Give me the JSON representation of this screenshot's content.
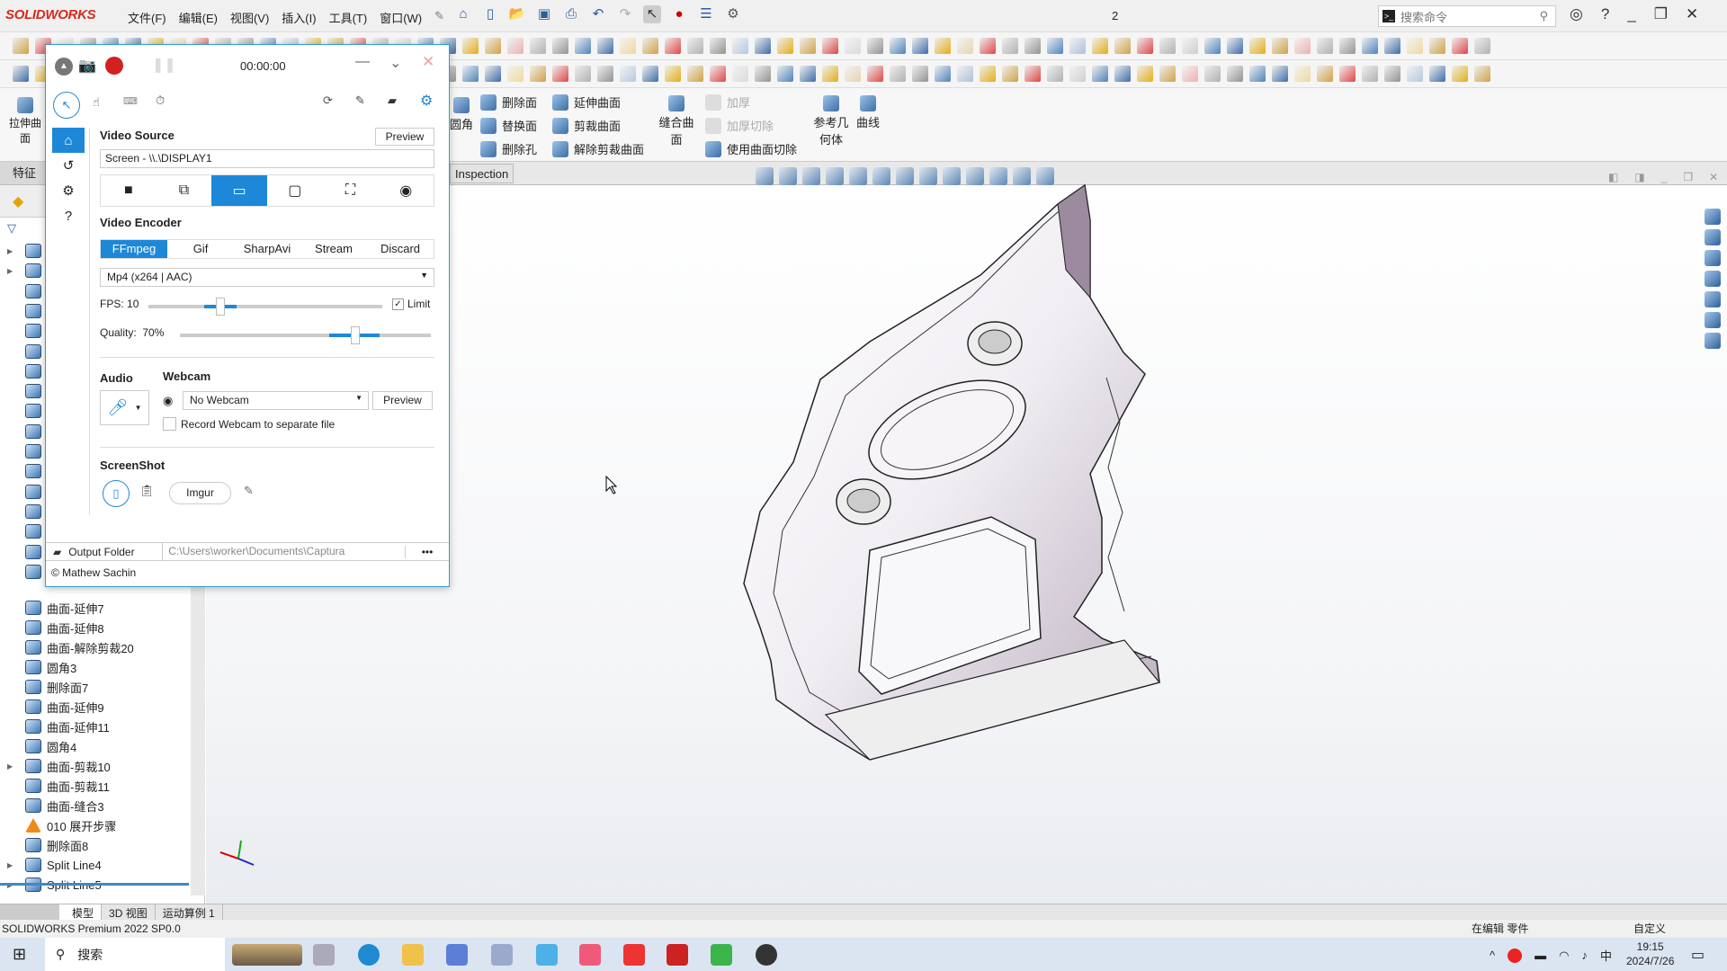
{
  "app": {
    "logo": "SOLIDWORKS",
    "doc_number": "2",
    "menu": [
      "文件(F)",
      "编辑(E)",
      "视图(V)",
      "插入(I)",
      "工具(T)",
      "窗口(W)"
    ],
    "search_placeholder": "搜索命令",
    "quick_access_icons": [
      "home-icon",
      "new-document-icon",
      "open-icon",
      "save-icon",
      "print-icon",
      "undo-icon",
      "redo-icon",
      "select-icon",
      "traffic-light-icon",
      "file-properties-icon",
      "options-gear-icon"
    ]
  },
  "ribbon": {
    "extrude_surface": "拉伸曲面",
    "fillet": "圆角",
    "col1": [
      "删除面",
      "替换面",
      "删除孔"
    ],
    "col2": [
      "延伸曲面",
      "剪裁曲面",
      "解除剪裁曲面"
    ],
    "knit": "缝合曲面",
    "col3": [
      "加厚",
      "加厚切除",
      "使用曲面切除"
    ],
    "ref_geom": "参考几何体",
    "curves": "曲线"
  },
  "tabs": {
    "feature": "特征",
    "inspection": "Inspection"
  },
  "tree": {
    "items": [
      {
        "label": "曲面-延伸7",
        "icon": "surface-extend-icon"
      },
      {
        "label": "曲面-延伸8",
        "icon": "surface-extend-icon"
      },
      {
        "label": "曲面-解除剪裁20",
        "icon": "untrim-surface-icon"
      },
      {
        "label": "圆角3",
        "icon": "fillet-icon"
      },
      {
        "label": "删除面7",
        "icon": "delete-face-icon"
      },
      {
        "label": "曲面-延伸9",
        "icon": "surface-extend-icon"
      },
      {
        "label": "曲面-延伸11",
        "icon": "surface-extend-icon"
      },
      {
        "label": "圆角4",
        "icon": "fillet-icon"
      },
      {
        "label": "曲面-剪裁10",
        "icon": "trim-surface-icon",
        "expandable": true
      },
      {
        "label": "曲面-剪裁11",
        "icon": "trim-surface-icon"
      },
      {
        "label": "曲面-缝合3",
        "icon": "knit-surface-icon"
      },
      {
        "label": "010 展开步骤",
        "icon": "flatten-step-icon"
      },
      {
        "label": "删除面8",
        "icon": "delete-face-icon"
      },
      {
        "label": "Split Line4",
        "icon": "split-line-icon",
        "expandable": true
      },
      {
        "label": "Split Line5",
        "icon": "split-line-icon",
        "expandable": true
      }
    ]
  },
  "bottom_tabs": [
    "模型",
    "3D 视图",
    "运动算例 1"
  ],
  "status": {
    "product": "SOLIDWORKS Premium 2022 SP0.0",
    "editing": "在编辑 零件",
    "units": "自定义"
  },
  "taskbar": {
    "search": "搜索",
    "time": "19:15",
    "date": "2024/7/26",
    "ime": "中"
  },
  "captura": {
    "timer": "00:00:00",
    "video_source": {
      "title": "Video Source",
      "preview": "Preview",
      "value": "Screen - \\\\.\\DISPLAY1",
      "sources": [
        "webcam-icon",
        "region-icon",
        "screen-icon",
        "window-icon",
        "fullscreen-icon",
        "gamepad-icon"
      ],
      "selected": "screen-icon"
    },
    "video_encoder": {
      "title": "Video Encoder",
      "tabs": [
        "FFmpeg",
        "Gif",
        "SharpAvi",
        "Stream",
        "Discard"
      ],
      "selected": "FFmpeg",
      "format": "Mp4 (x264 | AAC)"
    },
    "fps": {
      "label": "FPS:",
      "value": "10",
      "limit_label": "Limit",
      "limit_checked": true
    },
    "quality": {
      "label": "Quality:",
      "value": "70%"
    },
    "audio": {
      "title": "Audio"
    },
    "webcam": {
      "title": "Webcam",
      "value": "No Webcam",
      "preview": "Preview",
      "separate_file": "Record Webcam to separate file",
      "separate_checked": false
    },
    "screenshot": {
      "title": "ScreenShot",
      "imgur": "Imgur"
    },
    "output": {
      "label": "Output Folder",
      "path": "C:\\Users\\worker\\Documents\\Captura",
      "more": "•••"
    },
    "credit": "© Mathew Sachin",
    "accent": "#1e88d8"
  }
}
